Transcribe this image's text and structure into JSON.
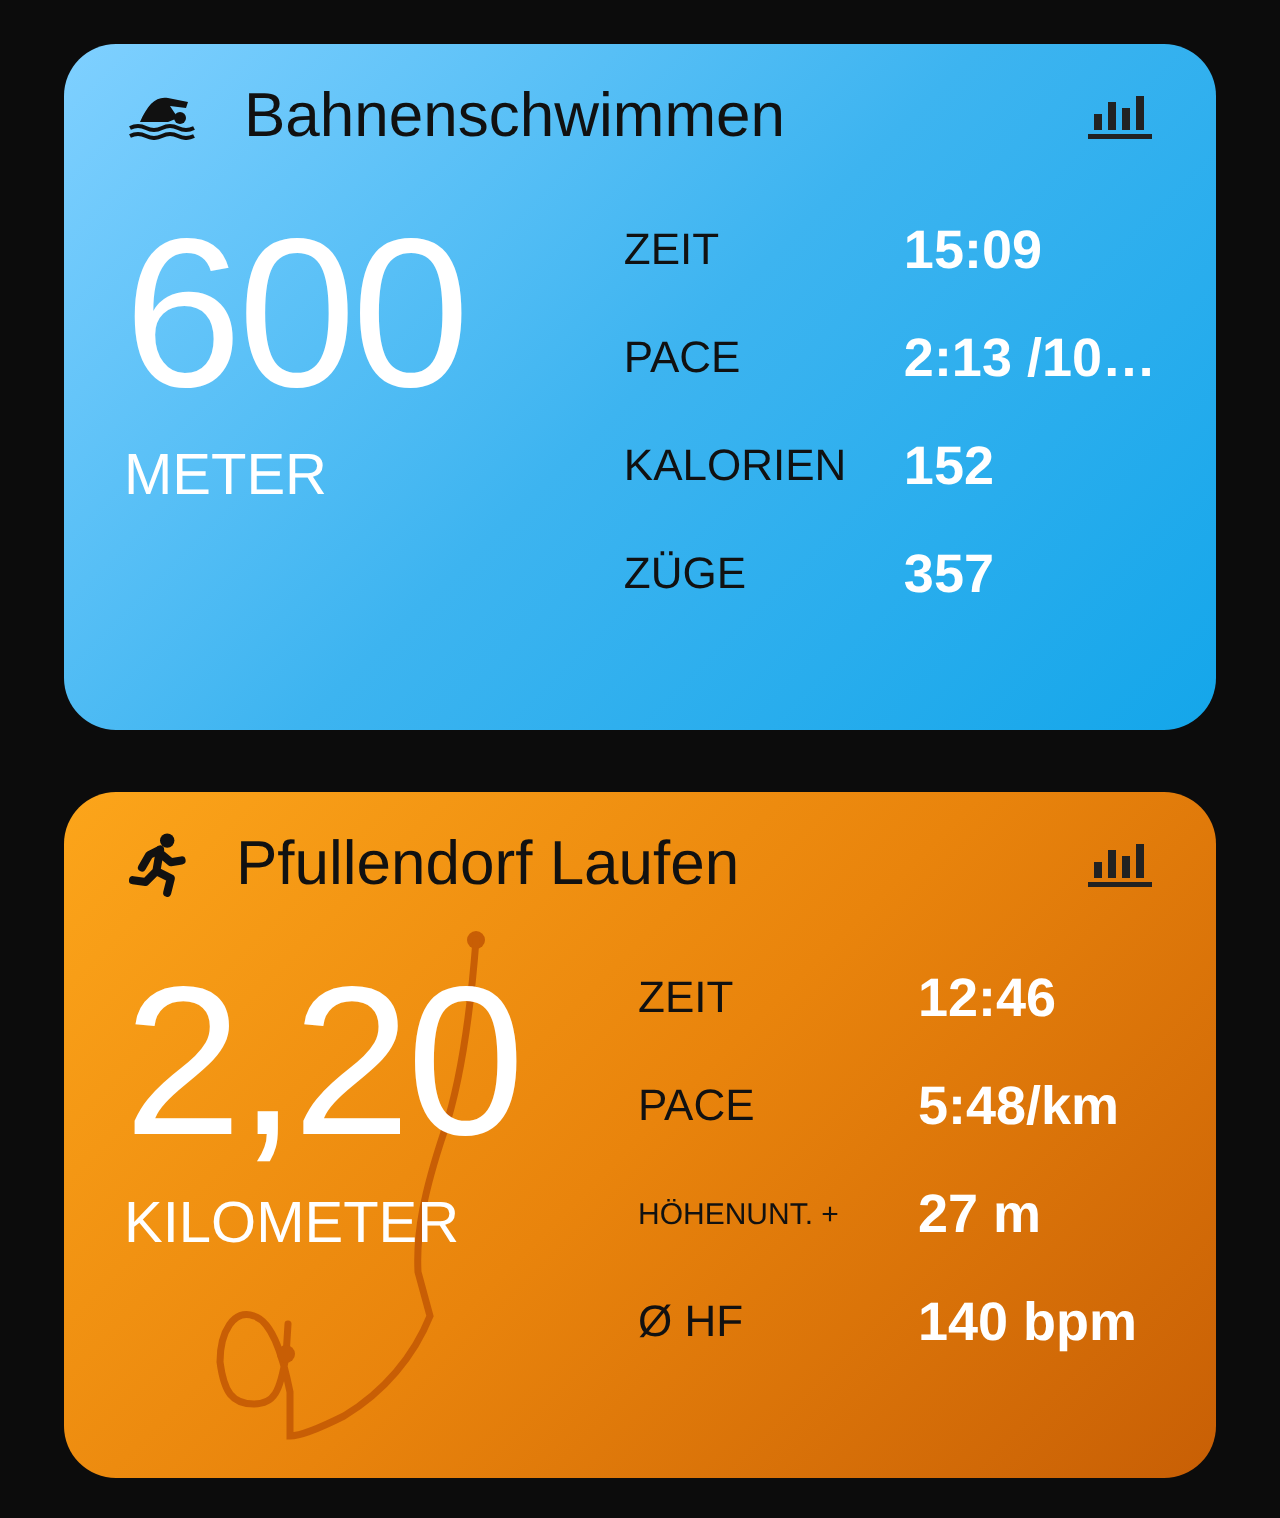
{
  "workouts": [
    {
      "kind": "swim",
      "title": "Bahnenschwimmen",
      "amount": "600",
      "unit": "METER",
      "stats": [
        {
          "label": "ZEIT",
          "value": "15:09",
          "kind": "normal"
        },
        {
          "label": "PACE",
          "value": "2:13 /10…",
          "kind": "normal"
        },
        {
          "label": "KALORIEN",
          "value": "152",
          "kind": "normal"
        },
        {
          "label": "ZÜGE",
          "value": "357",
          "kind": "normal"
        }
      ]
    },
    {
      "kind": "run",
      "title": "Pfullendorf Laufen",
      "amount": "2,20",
      "unit": "KILOMETER",
      "stats": [
        {
          "label": "ZEIT",
          "value": "12:46",
          "kind": "normal"
        },
        {
          "label": "PACE",
          "value": "5:48/km",
          "kind": "normal"
        },
        {
          "label": "HÖHENUNT. +",
          "value": "27 m",
          "kind": "compact"
        },
        {
          "label": "Ø HF",
          "value": "140 bpm",
          "kind": "normal"
        }
      ]
    }
  ]
}
